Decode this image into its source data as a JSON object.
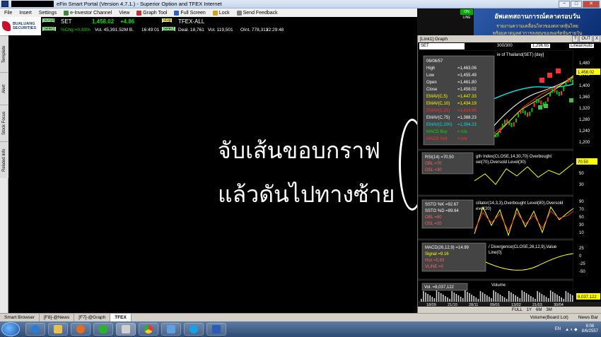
{
  "window": {
    "title": "eFin Smart Portal (Version 4.7.1.) - Superior Option and TFEX Internet",
    "minimize": "−",
    "maximize": "□",
    "close": "✕"
  },
  "menu": {
    "items": [
      "File",
      "Insert",
      "Settings",
      "e-Investor Channel",
      "View",
      "Graph Tool",
      "Full Screen",
      "Lock",
      "Send Feedback"
    ]
  },
  "logo": {
    "line1": "BUALUANG",
    "line2": "SECURITIES"
  },
  "ticker": {
    "symbol_tag": "Script",
    "select_tag": "Select",
    "symbol": "SET",
    "price": "1,458.02",
    "change": "+4.86",
    "pct_change": "%Chg.+0.33%",
    "volume": "Vol. 45,391.52M B.",
    "time": "16:49:01",
    "stop_tag": "Stop",
    "script_tag2": "Script",
    "select_tag2": "Select",
    "symbol2": "TFEX-ALL",
    "deal": "Deal. 18,761",
    "vol2": "Vol. 119,501",
    "oi": "OInt. 778,313",
    "time2": "22:29:48"
  },
  "banner": {
    "online": "ON LINE",
    "line1": "อัพเดทสถานการณ์ตลาดรอบวัน",
    "line2": "รายงานความเคลื่อนไหวของตลาดหุ้นไทย",
    "line3": "พร้อมคาดมูลค่าการลงทุนของพอร์ตหุ้นรายวัน"
  },
  "sidebar": {
    "tabs": [
      "Template",
      "Alert",
      "Stock Focus",
      "Related Info"
    ]
  },
  "overlay": {
    "line1": "จับเส้นขอบกราฟ",
    "line2": "แล้วดันไปทางซ้าย"
  },
  "chart": {
    "header": "[Link1] Graph",
    "header_btns": [
      "?",
      "OUT",
      "X"
    ],
    "symbol": "SET",
    "range_count": "300/300",
    "last_price": "1,296.65",
    "scale": "Linear/Auto",
    "panel_title": "ie of Thailand(SET) [day]",
    "info_box": [
      {
        "label": "06/06/57",
        "value": "",
        "color": "#ffffff"
      },
      {
        "label": "High",
        "value": "=1,463.06",
        "color": "#ffffff"
      },
      {
        "label": "Low",
        "value": "=1,455.49",
        "color": "#ffffff"
      },
      {
        "label": "Open",
        "value": "=1,461.80",
        "color": "#ffffff"
      },
      {
        "label": "Close",
        "value": "=1,458.02",
        "color": "#ffffff"
      },
      {
        "label": "EMAV(C,5)",
        "value": "=1,447.33",
        "color": "#ffff00"
      },
      {
        "label": "EMAV(C,10)",
        "value": "=1,434.19",
        "color": "#ffff00"
      },
      {
        "label": "EMAV(C,25)",
        "value": "=1,414.95",
        "color": "#ff3030"
      },
      {
        "label": "EMAV(C,75)",
        "value": "=1,388.23",
        "color": "#ffffff"
      },
      {
        "label": "EMAV(C,200)",
        "value": "=1,394.23",
        "color": "#00e0e0"
      },
      {
        "label": "MACD Buy",
        "value": "= n/a",
        "color": "#00e000"
      },
      {
        "label": "MACD Sell",
        "value": "= n/a",
        "color": "#ff3030"
      }
    ],
    "price_axis": [
      "1,480",
      "1,440",
      "1,400",
      "1,360",
      "1,320",
      "1,280",
      "1,240",
      "1,200"
    ],
    "price_tag": "1,458.02",
    "rsi": {
      "box": [
        "RSI(14) =70.50",
        "OBL =70",
        "OSL =30"
      ],
      "title": "gth Index(CLOSE,14,30,70) Overbought",
      "title2": "vel(70),Oversold Level(30)",
      "axis": [
        "70",
        "50",
        "30"
      ],
      "tag": "70.50"
    },
    "sto": {
      "box": [
        "SSTO %K =92.67",
        "SSTO %D =89.64",
        "OBL =80",
        "OSL =20"
      ],
      "title": "cillator(14,3,3),Overbought Level(80),Oversold",
      "title2": "evel(20)",
      "axis": [
        "90",
        "70",
        "50",
        "30",
        "10"
      ]
    },
    "macd": {
      "box": [
        "MACD(26,12,9) =14.99",
        "Signal =9.16",
        "Hist =5.83",
        "VLINE =0"
      ],
      "title": "/ Divergence(CLOSE,26,12,9),Value",
      "title2": "Line(0)",
      "axis": [
        "25",
        "0",
        "-25",
        "-50"
      ]
    },
    "volume": {
      "box": "Vol. =8,037,122",
      "title": "Volume",
      "tag": "8,037,122"
    },
    "x_labels": [
      "18/09",
      "21/10",
      "28/11",
      "09/01",
      "13/02",
      "21/03",
      "30/04"
    ],
    "x_labels2": [
      "2556",
      "Sep",
      "Oct",
      "Nov",
      "Dec",
      "2557",
      "Feb",
      "Mar",
      "Apr",
      "May"
    ],
    "bottom": [
      "FULL",
      "1Y",
      "6M",
      "3M"
    ]
  },
  "tabs": {
    "items": [
      "Smart Browser",
      "[F8]-@News",
      "[F7]-@Graph",
      "TFEX"
    ],
    "active": "TFEX",
    "right": [
      "Volume(Board Lot)",
      "News Bar"
    ]
  },
  "taskbar": {
    "lang": "EN",
    "time": "8:08",
    "date": "8/6/2557"
  }
}
